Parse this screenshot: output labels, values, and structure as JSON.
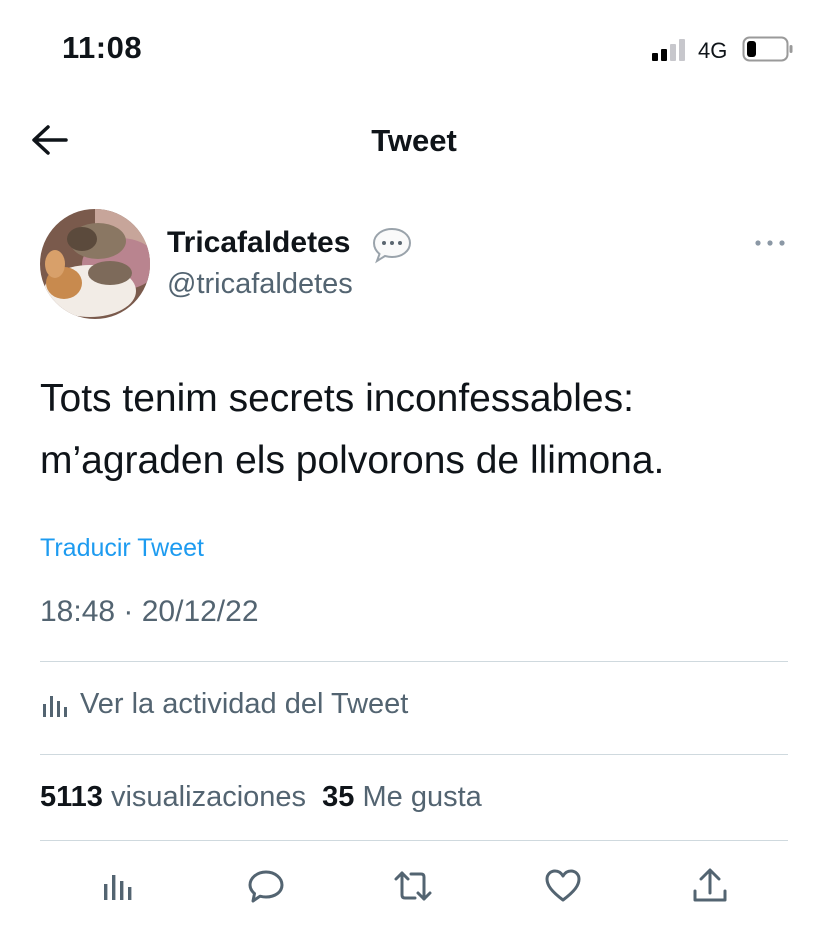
{
  "status_bar": {
    "time": "11:08",
    "network": "4G"
  },
  "nav": {
    "title": "Tweet"
  },
  "author": {
    "name": "Tricafaldetes",
    "handle": "@tricafaldetes"
  },
  "tweet": {
    "line1": "Tots tenim secrets inconfessables:",
    "line2": "m’agraden els polvorons de llimona."
  },
  "translate_label": "Traducir Tweet",
  "timestamp": "18:48 · 20/12/22",
  "activity_label": "Ver la actividad del Tweet",
  "stats": {
    "views_count": "5113",
    "views_label": "visualizaciones",
    "likes_count": "35",
    "likes_label": "Me gusta"
  },
  "colors": {
    "accent": "#1d9bf0",
    "secondary_text": "#536471",
    "divider": "#cfd9de"
  },
  "icons": [
    "back-arrow-icon",
    "speech-bubble-icon",
    "more-icon",
    "analytics-icon",
    "reply-icon",
    "retweet-icon",
    "like-icon",
    "share-icon"
  ]
}
